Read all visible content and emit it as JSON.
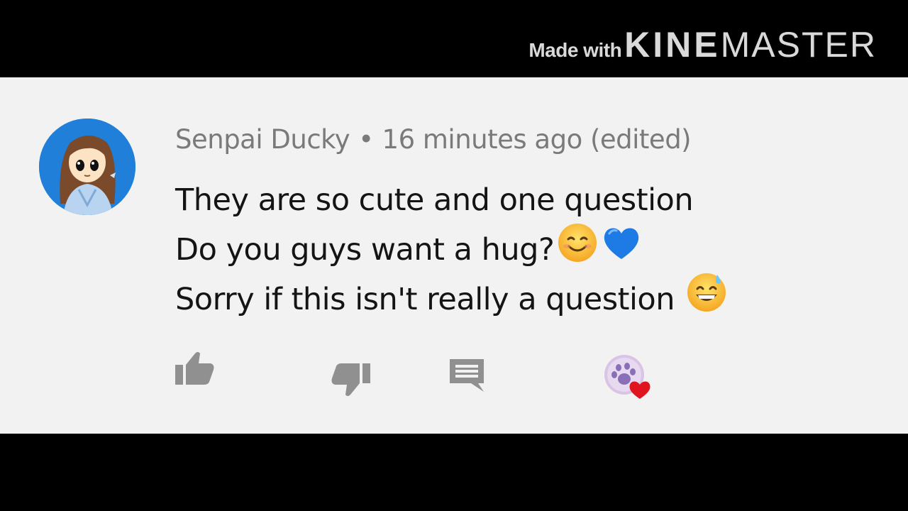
{
  "watermark": {
    "made_with": "Made with",
    "brand_kine": "KINE",
    "brand_master": "MASTER"
  },
  "comment": {
    "author": "Senpai Ducky",
    "separator": "•",
    "time": "16 minutes ago (edited)",
    "lines": [
      "They are so cute and one question",
      "Do you guys want a hug?",
      "Sorry if this isn't really a question"
    ]
  },
  "icons": {
    "like": "thumbs-up-icon",
    "dislike": "thumbs-down-icon",
    "reply": "reply-icon",
    "creator_heart": "creator-heart-icon"
  },
  "colors": {
    "panel": "#f2f2f2",
    "avatar_bg": "#1f7fd9",
    "text": "#141414",
    "meta": "#7a7a7a",
    "icon": "#909090",
    "heart": "#e0141e"
  }
}
